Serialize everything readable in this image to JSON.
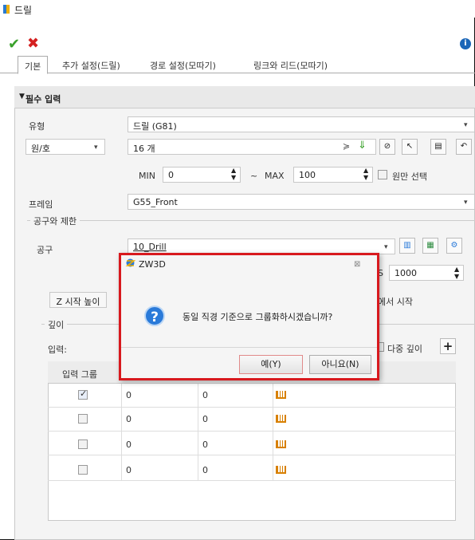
{
  "window": {
    "title": "드릴"
  },
  "tabs": [
    "기본",
    "추가 설정(드릴)",
    "경로 설정(모따기)",
    "링크와 리드(모따기)"
  ],
  "section": {
    "title": "필수 입력"
  },
  "form": {
    "type_label": "유형",
    "type_value": "드릴 (G81)",
    "hole_select_value": "원/호",
    "hole_count_value": "16 개",
    "min_label": "MIN",
    "min_value": "0",
    "tilde": "~",
    "max_label": "MAX",
    "max_value": "100",
    "full_circle_label": "원만 선택",
    "frame_label": "프레임",
    "frame_value": "G55_Front",
    "tool_limit_title": "공구와 제한",
    "tool_label": "공구",
    "tool_value": "10_Drill",
    "speed_prefix": "S",
    "speed_value": "1000",
    "z_start_button": "Z 시작 높이",
    "start_from_text": "에서 시작",
    "depth_title": "깊이",
    "input_label": "입력:",
    "multi_depth_label": "다중 깊이",
    "add_symbol": "+"
  },
  "table": {
    "header_first": "입력 그룹",
    "rows": [
      {
        "checked": true,
        "c1": "0",
        "c2": "0"
      },
      {
        "checked": false,
        "c1": "0",
        "c2": "0"
      },
      {
        "checked": false,
        "c1": "0",
        "c2": "0"
      },
      {
        "checked": false,
        "c1": "0",
        "c2": "0"
      }
    ]
  },
  "dialog": {
    "title": "ZW3D",
    "message": "동일 직경 기준으로 그룹화하시겠습니까?",
    "yes": "예(Y)",
    "no": "아니요(N)",
    "close": "⊠"
  },
  "icons": [
    "app-icon",
    "check-icon",
    "close-icon",
    "info-icon",
    "question-icon",
    "ruler-icon"
  ],
  "colors": {
    "accent": "#d8191e",
    "ok": "#3aa12b",
    "cancel": "#d42020",
    "question": "#2a7ad9"
  }
}
